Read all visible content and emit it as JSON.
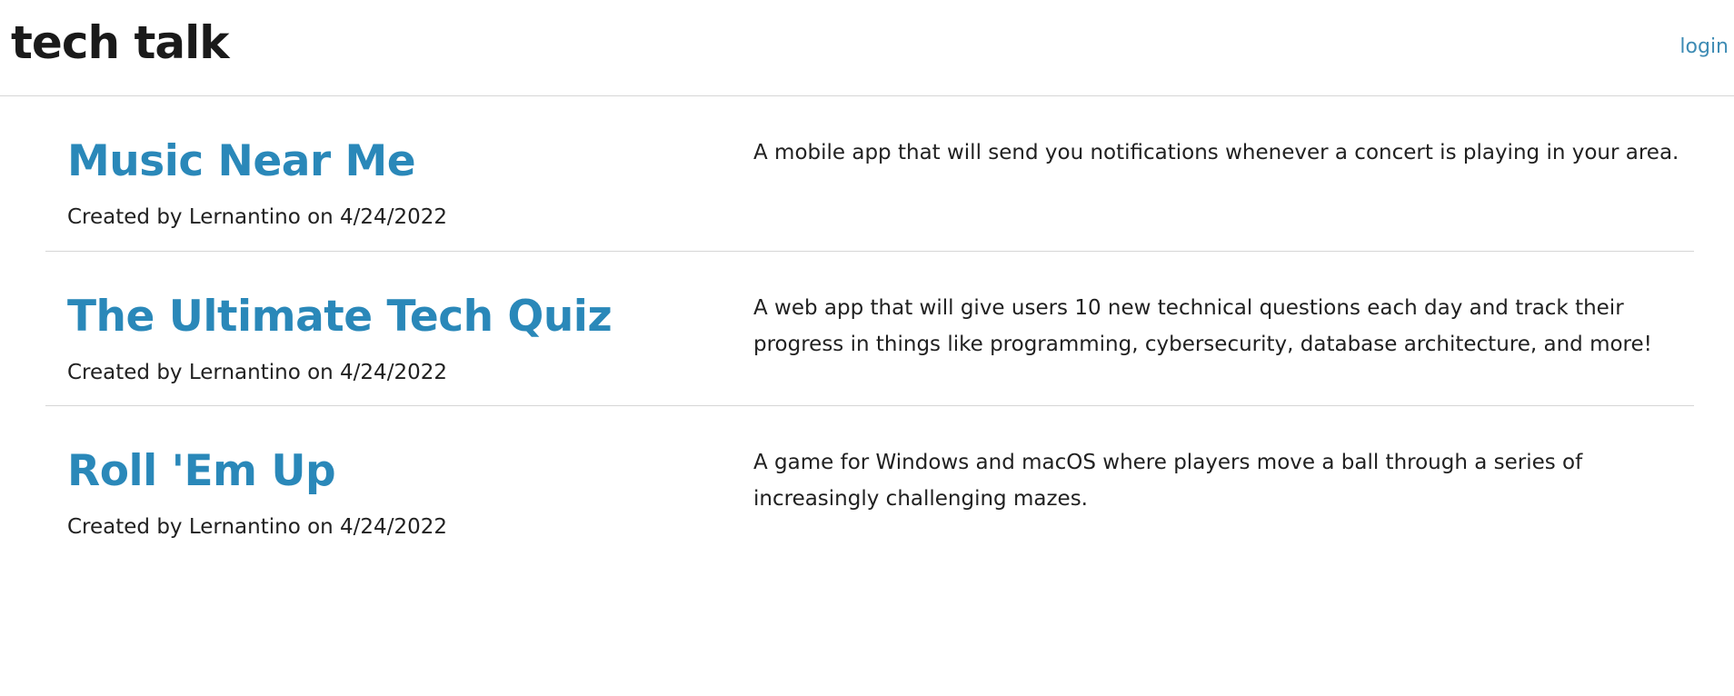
{
  "header": {
    "title": "tech talk",
    "login_label": "login"
  },
  "posts": [
    {
      "title": "Music Near Me",
      "author": "Lernantino",
      "date": "4/24/2022",
      "meta": "Created by Lernantino on 4/24/2022",
      "description": "A mobile app that will send you notifications whenever a concert is playing in your area."
    },
    {
      "title": "The Ultimate Tech Quiz",
      "author": "Lernantino",
      "date": "4/24/2022",
      "meta": "Created by Lernantino on 4/24/2022",
      "description": "A web app that will give users 10 new technical questions each day and track their progress in things like programming, cybersecurity, database architecture, and more!"
    },
    {
      "title": "Roll 'Em Up",
      "author": "Lernantino",
      "date": "4/24/2022",
      "meta": "Created by Lernantino on 4/24/2022",
      "description": "A game for Windows and macOS where players move a ball through a series of increasingly challenging mazes."
    }
  ],
  "colors": {
    "post_title": "#2a88b9",
    "login_link": "#3d8bb4",
    "text": "#212121",
    "divider": "#d6d6d6"
  }
}
